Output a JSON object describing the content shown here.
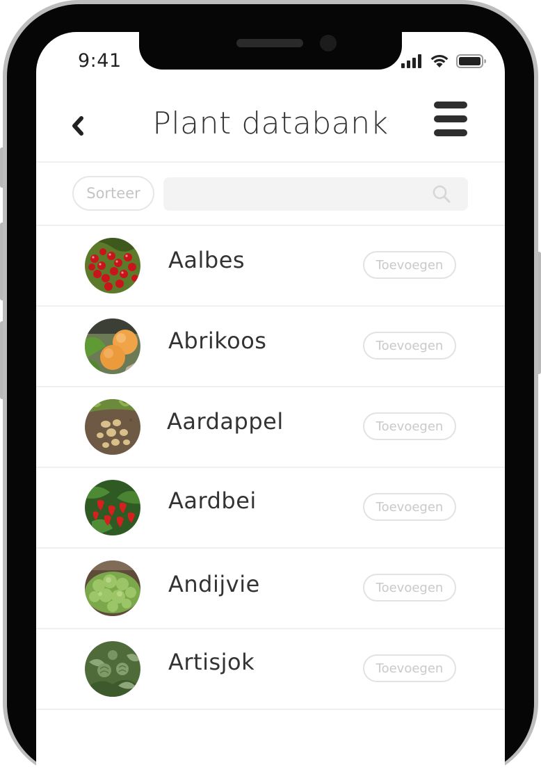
{
  "status_bar": {
    "time": "9:41"
  },
  "header": {
    "title": "Plant databank"
  },
  "toolbar": {
    "sort_label": "Sorteer",
    "search_value": "",
    "search_placeholder": ""
  },
  "plants": [
    {
      "name": "Aalbes",
      "add_label": "Toevoegen",
      "image": "red-currant-image"
    },
    {
      "name": "Abrikoos",
      "add_label": "Toevoegen",
      "image": "apricot-image"
    },
    {
      "name": "Aardappel",
      "add_label": "Toevoegen",
      "image": "potato-image"
    },
    {
      "name": "Aardbei",
      "add_label": "Toevoegen",
      "image": "strawberry-image"
    },
    {
      "name": "Andijvie",
      "add_label": "Toevoegen",
      "image": "endive-image"
    },
    {
      "name": "Artisjok",
      "add_label": "Toevoegen",
      "image": "artichoke-image"
    }
  ],
  "icons": {
    "back": "chevron-left-icon",
    "menu": "hamburger-menu-icon",
    "search": "search-icon",
    "signal": "cellular-signal-icon",
    "wifi": "wifi-icon",
    "battery": "battery-icon"
  },
  "colors": {
    "text": "#333333",
    "muted": "#c9c9c9",
    "divider": "#f0f0f0",
    "field": "#f3f3f3"
  }
}
